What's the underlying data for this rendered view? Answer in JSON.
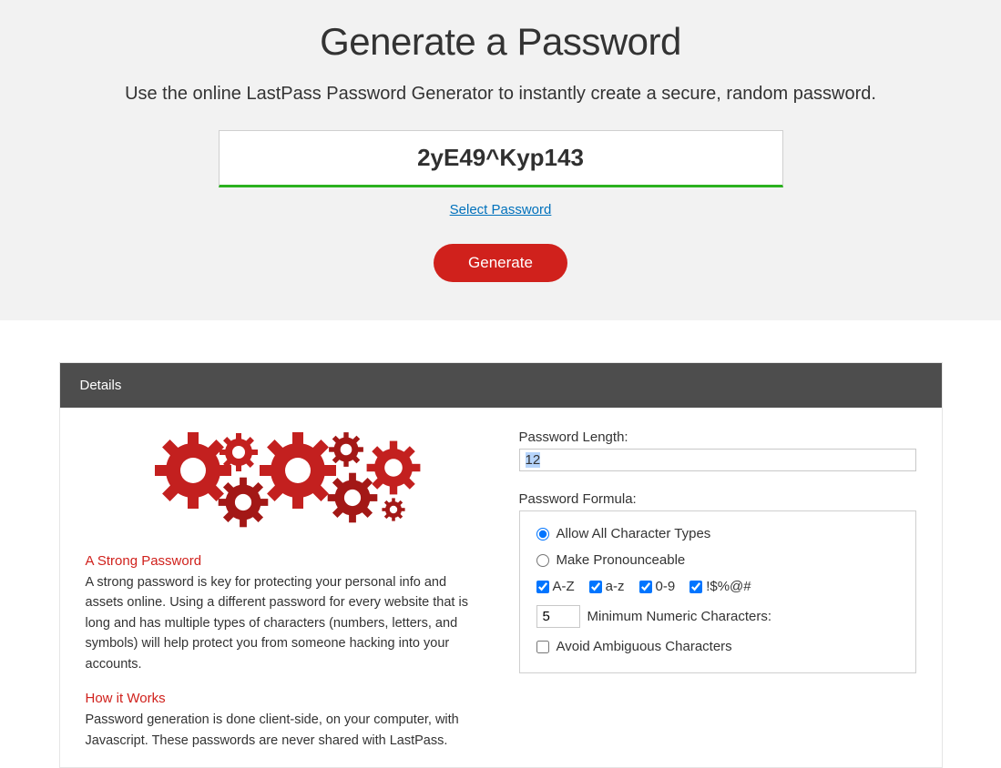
{
  "hero": {
    "title": "Generate a Password",
    "subtitle": "Use the online LastPass Password Generator to instantly create a secure, random password.",
    "password": "2yE49^Kyp143",
    "select_link": "Select Password",
    "generate_btn": "Generate"
  },
  "panel": {
    "header": "Details"
  },
  "info": {
    "strong_title": "A Strong Password",
    "strong_body": "A strong password is key for protecting your personal info and assets online. Using a different password for every website that is long and has multiple types of characters (numbers, letters, and symbols) will help protect you from someone hacking into your accounts.",
    "how_title": "How it Works",
    "how_body": "Password generation is done client-side, on your computer, with Javascript. These passwords are never shared with LastPass."
  },
  "form": {
    "length_label": "Password Length:",
    "length_value": "12",
    "formula_label": "Password Formula:",
    "radio_all": "Allow All Character Types",
    "radio_pron": "Make Pronounceable",
    "chk_upper": "A-Z",
    "chk_lower": "a-z",
    "chk_digits": "0-9",
    "chk_symbols": "!$%@#",
    "min_numeric_value": "5",
    "min_numeric_label": "Minimum Numeric Characters:",
    "avoid_label": "Avoid Ambiguous Characters"
  }
}
